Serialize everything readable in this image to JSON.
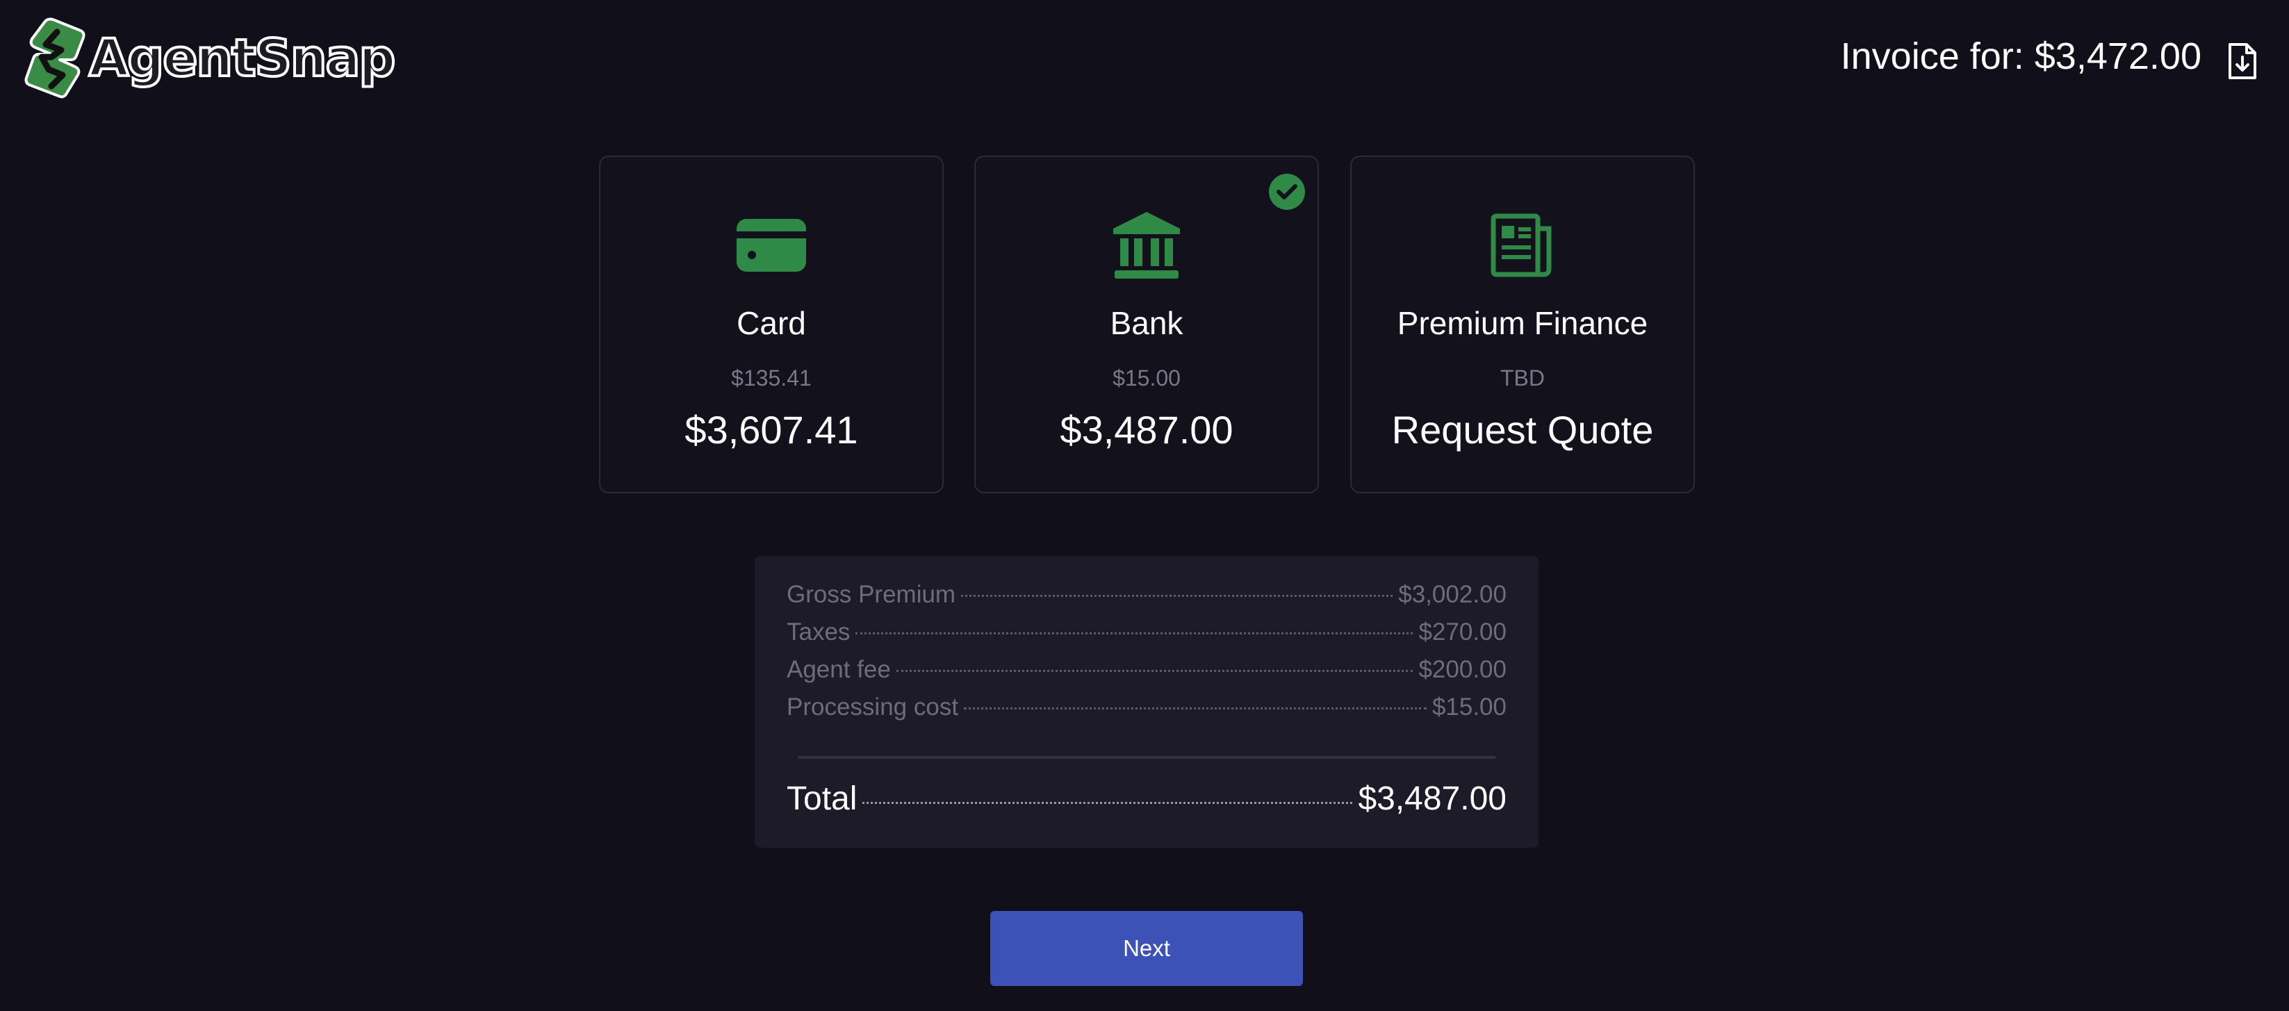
{
  "brand": {
    "name": "AgentSnap",
    "accent": "#2f8a47"
  },
  "header": {
    "invoice_title": "Invoice for: $3,472.00",
    "download_icon": "file-download-icon"
  },
  "payment_options": [
    {
      "name": "Card",
      "fee": "$135.41",
      "amount": "$3,607.41",
      "icon": "credit-card-icon",
      "selected": false
    },
    {
      "name": "Bank",
      "fee": "$15.00",
      "amount": "$3,487.00",
      "icon": "bank-icon",
      "selected": true
    },
    {
      "name": "Premium Finance",
      "fee": "TBD",
      "amount": "Request Quote",
      "icon": "newspaper-icon",
      "selected": false
    }
  ],
  "summary": {
    "lines": [
      {
        "label": "Gross Premium",
        "value": "$3,002.00"
      },
      {
        "label": "Taxes",
        "value": "$270.00"
      },
      {
        "label": "Agent fee",
        "value": "$200.00"
      },
      {
        "label": "Processing cost",
        "value": "$15.00"
      }
    ],
    "total": {
      "label": "Total",
      "value": "$3,487.00"
    }
  },
  "actions": {
    "next_label": "Next",
    "next_color": "#3d52b7"
  }
}
